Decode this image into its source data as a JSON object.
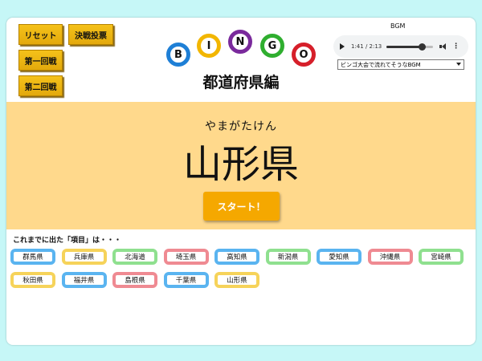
{
  "buttons": {
    "reset": "リセット",
    "final": "決戦投票",
    "round1": "第一回戦",
    "round2": "第二回戦"
  },
  "logo": {
    "letters": [
      {
        "char": "B",
        "color": "#1e7fd6"
      },
      {
        "char": "I",
        "color": "#f2b600"
      },
      {
        "char": "N",
        "color": "#7a2a9c"
      },
      {
        "char": "G",
        "color": "#2fae2f"
      },
      {
        "char": "O",
        "color": "#d61f2a"
      }
    ],
    "subtitle": "都道府県編"
  },
  "bgm": {
    "label": "BGM",
    "time": "1:41 / 2:13",
    "progress": 0.76,
    "selected": "ビンゴ大会で流れてそうなBGM"
  },
  "current": {
    "ruby": "やまがたけん",
    "name": "山形県",
    "start_label": "スタート！"
  },
  "history": {
    "label": "これまでに出た「項目」は・・・",
    "items": [
      {
        "name": "群馬県",
        "color": "#5ab4f0"
      },
      {
        "name": "兵庫県",
        "color": "#f6d35a"
      },
      {
        "name": "北海道",
        "color": "#8fe08f"
      },
      {
        "name": "埼玉県",
        "color": "#ef8a92"
      },
      {
        "name": "高知県",
        "color": "#5ab4f0"
      },
      {
        "name": "新潟県",
        "color": "#8fe08f"
      },
      {
        "name": "愛知県",
        "color": "#5ab4f0"
      },
      {
        "name": "沖縄県",
        "color": "#ef8a92"
      },
      {
        "name": "宮崎県",
        "color": "#8fe08f"
      },
      {
        "name": "秋田県",
        "color": "#f6d35a"
      },
      {
        "name": "福井県",
        "color": "#5ab4f0"
      },
      {
        "name": "島根県",
        "color": "#ef8a92"
      },
      {
        "name": "千葉県",
        "color": "#5ab4f0"
      },
      {
        "name": "山形県",
        "color": "#f6d35a"
      }
    ]
  }
}
